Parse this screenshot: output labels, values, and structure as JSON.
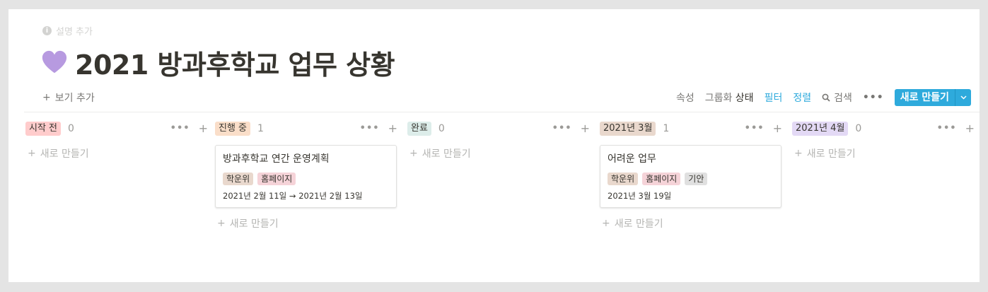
{
  "header": {
    "add_description": "설명 추가",
    "title": "2021 방과후학교 업무 상황",
    "title_icon": "purple-heart-icon"
  },
  "toolbar": {
    "add_view": "보기 추가",
    "properties": "속성",
    "group_by_label": "그룹화",
    "group_by_value": "상태",
    "filter": "필터",
    "sort": "정렬",
    "search": "검색",
    "more": "•••",
    "new_button": "새로 만들기"
  },
  "colors": {
    "accent_blue": "#2eaadc",
    "tag_red": "#ffcccc",
    "tag_orange": "#fadec9",
    "tag_green": "#ddedea",
    "tag_brown": "#e9d8cd",
    "tag_purple": "#e3d9f5",
    "tag_pink": "#f5d3d8",
    "tag_gray": "#e0e0e0"
  },
  "columns": [
    {
      "name": "시작 전",
      "count": "0",
      "new_label": "새로 만들기"
    },
    {
      "name": "진행 중",
      "count": "1",
      "new_label": "새로 만들기",
      "card": {
        "title": "방과후학교 연간 운영계획",
        "tags": [
          "학운위",
          "홈페이지"
        ],
        "date": "2021년 2월 11일 → 2021년 2월 13일"
      }
    },
    {
      "name": "완료",
      "count": "0",
      "new_label": "새로 만들기"
    },
    {
      "name": "2021년 3월",
      "count": "1",
      "new_label": "새로 만들기",
      "card": {
        "title": "어려운 업무",
        "tags": [
          "학운위",
          "홈페이지",
          "기안"
        ],
        "date": "2021년 3월 19일"
      }
    },
    {
      "name": "2021년 4월",
      "count": "0",
      "new_label": "새로 만들기"
    }
  ]
}
